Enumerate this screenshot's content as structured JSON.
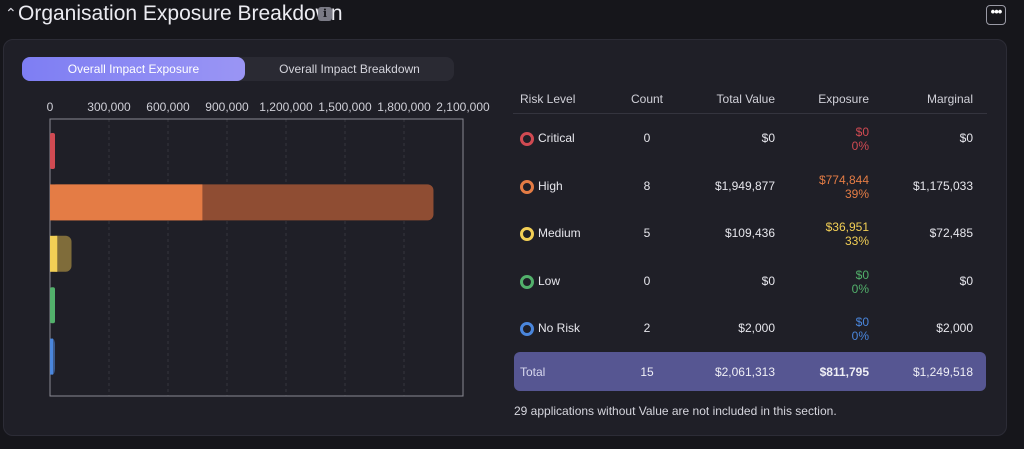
{
  "header": {
    "collapse_icon": "chevron-up-icon",
    "title": "Organisation Exposure Breakdown",
    "info_icon_glyph": "i",
    "more_icon": "•••"
  },
  "tabs": [
    {
      "label": "Overall Impact Exposure",
      "active": true
    },
    {
      "label": "Overall Impact Breakdown",
      "active": false
    }
  ],
  "chart_data": {
    "type": "bar",
    "orientation": "horizontal",
    "stacked": true,
    "xlim": [
      0,
      2100000
    ],
    "x_ticks": [
      "0",
      "300,000",
      "600,000",
      "900,000",
      "1,200,000",
      "1,500,000",
      "1,800,000",
      "2,100,000"
    ],
    "x_tick_values": [
      0,
      300000,
      600000,
      900000,
      1200000,
      1500000,
      1800000,
      2100000
    ],
    "grid": true,
    "categories": [
      "Critical",
      "High",
      "Medium",
      "Low",
      "No Risk"
    ],
    "colors": [
      "#d04a52",
      "#e47c45",
      "#f2cf55",
      "#52b06b",
      "#4a86dc"
    ],
    "marginal_colors": [
      "#8a3a40",
      "#8f4d33",
      "#7f6c3a",
      "#3d6a48",
      "#3b5a8d"
    ],
    "series": [
      {
        "values": [
          0,
          774844,
          36951,
          0,
          0
        ]
      },
      {
        "values": [
          0,
          1175033,
          72485,
          0,
          2000
        ]
      }
    ]
  },
  "table": {
    "headers": {
      "level": "Risk Level",
      "count": "Count",
      "total": "Total Value",
      "exposure": "Exposure",
      "marginal": "Marginal"
    },
    "rows": [
      {
        "level": "Critical",
        "count": "0",
        "total": "$0",
        "exposure": "$0",
        "exposure_pct": "0%",
        "marginal": "$0",
        "color": "#d04a52"
      },
      {
        "level": "High",
        "count": "8",
        "total": "$1,949,877",
        "exposure": "$774,844",
        "exposure_pct": "39%",
        "marginal": "$1,175,033",
        "color": "#e47c45"
      },
      {
        "level": "Medium",
        "count": "5",
        "total": "$109,436",
        "exposure": "$36,951",
        "exposure_pct": "33%",
        "marginal": "$72,485",
        "color": "#f2cf55"
      },
      {
        "level": "Low",
        "count": "0",
        "total": "$0",
        "exposure": "$0",
        "exposure_pct": "0%",
        "marginal": "$0",
        "color": "#52b06b"
      },
      {
        "level": "No Risk",
        "count": "2",
        "total": "$2,000",
        "exposure": "$0",
        "exposure_pct": "0%",
        "marginal": "$2,000",
        "color": "#4a86dc"
      }
    ],
    "total": {
      "level": "Total",
      "count": "15",
      "total": "$2,061,313",
      "exposure": "$811,795",
      "marginal": "$1,249,518"
    }
  },
  "footnote": "29 applications without Value are not included in this section."
}
